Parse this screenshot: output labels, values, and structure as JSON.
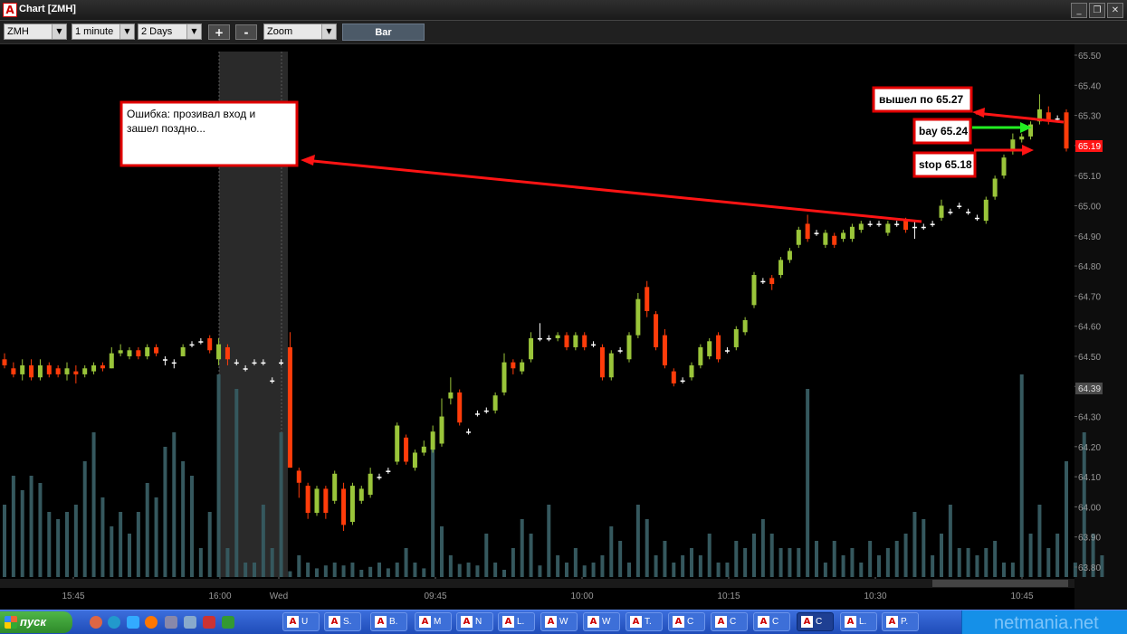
{
  "window": {
    "title": "Chart [ZMH]",
    "app_icon": "A"
  },
  "window_controls": {
    "minimize": "_",
    "restore": "❐",
    "close": "✕"
  },
  "toolbar": {
    "symbol": "ZMH",
    "interval": "1 minute",
    "period": "2 Days",
    "zoom_in": "+",
    "zoom_out": "-",
    "zoom_mode": "Zoom",
    "chart_type": "Bar"
  },
  "chart_data": {
    "type": "candlestick",
    "title": "",
    "ylim": [
      63.75,
      65.55
    ],
    "y_ticks": [
      "65.50",
      "65.40",
      "65.30",
      "65.20",
      "65.10",
      "65.00",
      "64.90",
      "64.80",
      "64.70",
      "64.60",
      "64.50",
      "64.40",
      "64.30",
      "64.20",
      "64.10",
      "64.00",
      "63.90",
      "63.80"
    ],
    "x_ticks": [
      "15:45",
      "16:00",
      "Wed",
      "09:45",
      "10:00",
      "10:15",
      "10:30",
      "10:45"
    ],
    "price_labels": {
      "last": "65.19",
      "marker": "64.39"
    },
    "colors": {
      "up": "#9ac53a",
      "down": "#ff3c0a",
      "flat": "#ffffff",
      "volume": "#35585e",
      "annotation": "#ff1414",
      "arrow_green": "#22ee22"
    },
    "annotations": {
      "error_note": "Ошибка: прозивал вход и зашел поздно...",
      "exit_note": "вышел по 65.27",
      "buy_note": "bay 65.24",
      "stop_note": "stop 65.18"
    },
    "candles": [
      [
        64.49,
        64.47,
        64.51,
        64.46
      ],
      [
        64.46,
        64.44,
        64.48,
        64.43
      ],
      [
        64.44,
        64.47,
        64.49,
        64.42
      ],
      [
        64.47,
        64.43,
        64.49,
        64.42
      ],
      [
        64.43,
        64.47,
        64.49,
        64.42
      ],
      [
        64.47,
        64.44,
        64.48,
        64.43
      ],
      [
        64.46,
        64.44,
        64.47,
        64.43
      ],
      [
        64.44,
        64.46,
        64.48,
        64.42
      ],
      [
        64.45,
        64.44,
        64.47,
        64.41
      ],
      [
        64.44,
        64.46,
        64.47,
        64.43
      ],
      [
        64.45,
        64.47,
        64.48,
        64.44
      ],
      [
        64.47,
        64.46,
        64.48,
        64.45
      ],
      [
        64.46,
        64.51,
        64.53,
        64.46
      ],
      [
        64.51,
        64.52,
        64.54,
        64.5
      ],
      [
        64.5,
        64.52,
        64.53,
        64.49
      ],
      [
        64.52,
        64.5,
        64.53,
        64.49
      ],
      [
        64.5,
        64.53,
        64.54,
        64.49
      ],
      [
        64.53,
        64.51,
        64.54,
        64.5
      ],
      [
        64.49,
        64.49,
        64.5,
        64.47
      ],
      [
        64.48,
        64.48,
        64.49,
        64.46
      ],
      [
        64.5,
        64.53,
        64.54,
        64.5
      ],
      [
        64.54,
        64.54,
        64.55,
        64.53
      ],
      [
        64.55,
        64.55,
        64.56,
        64.54
      ],
      [
        64.56,
        64.52,
        64.57,
        64.51
      ],
      [
        64.49,
        64.54,
        64.56,
        64.47
      ],
      [
        64.53,
        64.49,
        64.54,
        64.47
      ],
      [
        64.48,
        64.48,
        64.49,
        64.47
      ],
      [
        64.46,
        64.46,
        64.47,
        64.45
      ],
      [
        64.48,
        64.48,
        64.49,
        64.47
      ],
      [
        64.48,
        64.48,
        64.49,
        64.47
      ],
      [
        64.42,
        64.42,
        64.43,
        64.41
      ],
      [
        64.48,
        64.48,
        64.49,
        64.47
      ],
      [
        64.53,
        64.13,
        64.58,
        64.13
      ],
      [
        64.12,
        64.08,
        64.13,
        64.03
      ],
      [
        64.07,
        63.98,
        64.08,
        63.96
      ],
      [
        63.98,
        64.06,
        64.07,
        63.97
      ],
      [
        64.06,
        63.98,
        64.07,
        63.96
      ],
      [
        64.02,
        64.11,
        64.12,
        64.01
      ],
      [
        64.06,
        63.94,
        64.08,
        63.92
      ],
      [
        63.95,
        64.07,
        64.08,
        63.94
      ],
      [
        64.02,
        64.06,
        64.07,
        64.01
      ],
      [
        64.04,
        64.11,
        64.13,
        64.03
      ],
      [
        64.1,
        64.1,
        64.11,
        64.09
      ],
      [
        64.12,
        64.12,
        64.13,
        64.11
      ],
      [
        64.15,
        64.27,
        64.28,
        64.14
      ],
      [
        64.23,
        64.15,
        64.24,
        64.14
      ],
      [
        64.13,
        64.18,
        64.19,
        64.12
      ],
      [
        64.18,
        64.2,
        64.22,
        64.17
      ],
      [
        64.19,
        64.25,
        64.27,
        64.18
      ],
      [
        64.21,
        64.3,
        64.36,
        64.2
      ],
      [
        64.36,
        64.38,
        64.43,
        64.34
      ],
      [
        64.38,
        64.28,
        64.39,
        64.27
      ],
      [
        64.25,
        64.25,
        64.26,
        64.24
      ],
      [
        64.31,
        64.31,
        64.32,
        64.3
      ],
      [
        64.32,
        64.32,
        64.33,
        64.31
      ],
      [
        64.32,
        64.37,
        64.38,
        64.31
      ],
      [
        64.38,
        64.48,
        64.51,
        64.37
      ],
      [
        64.48,
        64.46,
        64.49,
        64.44
      ],
      [
        64.45,
        64.48,
        64.49,
        64.44
      ],
      [
        64.49,
        64.56,
        64.58,
        64.48
      ],
      [
        64.56,
        64.56,
        64.61,
        64.55
      ],
      [
        64.56,
        64.56,
        64.57,
        64.55
      ],
      [
        64.56,
        64.57,
        64.58,
        64.55
      ],
      [
        64.57,
        64.53,
        64.58,
        64.52
      ],
      [
        64.53,
        64.57,
        64.58,
        64.52
      ],
      [
        64.57,
        64.53,
        64.58,
        64.52
      ],
      [
        64.54,
        64.54,
        64.55,
        64.53
      ],
      [
        64.53,
        64.43,
        64.54,
        64.42
      ],
      [
        64.43,
        64.51,
        64.52,
        64.42
      ],
      [
        64.52,
        64.52,
        64.53,
        64.51
      ],
      [
        64.49,
        64.57,
        64.58,
        64.48
      ],
      [
        64.57,
        64.69,
        64.71,
        64.56
      ],
      [
        64.73,
        64.65,
        64.75,
        64.63
      ],
      [
        64.64,
        64.53,
        64.65,
        64.52
      ],
      [
        64.57,
        64.47,
        64.59,
        64.46
      ],
      [
        64.45,
        64.41,
        64.46,
        64.4
      ],
      [
        64.42,
        64.42,
        64.43,
        64.41
      ],
      [
        64.43,
        64.47,
        64.48,
        64.42
      ],
      [
        64.47,
        64.53,
        64.54,
        64.46
      ],
      [
        64.5,
        64.55,
        64.56,
        64.49
      ],
      [
        64.57,
        64.49,
        64.58,
        64.48
      ],
      [
        64.52,
        64.52,
        64.53,
        64.51
      ],
      [
        64.53,
        64.59,
        64.6,
        64.52
      ],
      [
        64.58,
        64.62,
        64.63,
        64.57
      ],
      [
        64.67,
        64.77,
        64.78,
        64.66
      ],
      [
        64.75,
        64.75,
        64.76,
        64.74
      ],
      [
        64.76,
        64.74,
        64.77,
        64.72
      ],
      [
        64.77,
        64.82,
        64.83,
        64.76
      ],
      [
        64.82,
        64.85,
        64.86,
        64.81
      ],
      [
        64.87,
        64.92,
        64.93,
        64.86
      ],
      [
        64.94,
        64.89,
        64.97,
        64.88
      ],
      [
        64.91,
        64.91,
        64.92,
        64.9
      ],
      [
        64.87,
        64.91,
        64.92,
        64.86
      ],
      [
        64.9,
        64.87,
        64.91,
        64.86
      ],
      [
        64.89,
        64.91,
        64.92,
        64.88
      ],
      [
        64.89,
        64.93,
        64.94,
        64.88
      ],
      [
        64.92,
        64.94,
        64.95,
        64.91
      ],
      [
        64.94,
        64.94,
        64.95,
        64.93
      ],
      [
        64.94,
        64.94,
        64.95,
        64.93
      ],
      [
        64.91,
        64.94,
        64.95,
        64.9
      ],
      [
        64.94,
        64.94,
        64.95,
        64.93
      ],
      [
        64.95,
        64.92,
        64.96,
        64.91
      ],
      [
        64.93,
        64.93,
        64.95,
        64.89
      ],
      [
        64.93,
        64.93,
        64.94,
        64.92
      ],
      [
        64.94,
        64.94,
        64.95,
        64.93
      ],
      [
        64.96,
        65.0,
        65.02,
        64.95
      ],
      [
        64.98,
        64.98,
        64.99,
        64.97
      ],
      [
        65.0,
        65.0,
        65.01,
        64.99
      ],
      [
        64.98,
        64.98,
        64.99,
        64.97
      ],
      [
        64.96,
        64.96,
        64.97,
        64.95
      ],
      [
        64.95,
        65.02,
        65.03,
        64.94
      ],
      [
        65.03,
        65.09,
        65.1,
        65.02
      ],
      [
        65.1,
        65.16,
        65.17,
        65.09
      ],
      [
        65.18,
        65.22,
        65.24,
        65.17
      ],
      [
        65.22,
        65.23,
        65.24,
        65.21
      ],
      [
        65.23,
        65.27,
        65.28,
        65.22
      ],
      [
        65.28,
        65.32,
        65.37,
        65.27
      ],
      [
        65.31,
        65.28,
        65.33,
        65.27
      ],
      [
        65.29,
        65.29,
        65.3,
        65.28
      ],
      [
        65.31,
        65.19,
        65.32,
        65.18
      ]
    ],
    "volume": [
      500,
      700,
      600,
      700,
      650,
      450,
      400,
      450,
      500,
      800,
      1000,
      550,
      350,
      450,
      300,
      450,
      650,
      550,
      900,
      1000,
      800,
      700,
      200,
      450,
      1400,
      200,
      1300,
      100,
      100,
      500,
      200,
      1000,
      40,
      150,
      100,
      60,
      80,
      100,
      80,
      100,
      50,
      70,
      100,
      60,
      100,
      200,
      100,
      60,
      1000,
      350,
      150,
      90,
      100,
      80,
      300,
      100,
      50,
      200,
      400,
      300,
      80,
      500,
      150,
      100,
      200,
      80,
      100,
      150,
      350,
      250,
      100,
      500,
      400,
      150,
      250,
      100,
      150,
      200,
      150,
      300,
      100,
      100,
      250,
      200,
      300,
      400,
      300,
      200,
      200,
      200,
      1300,
      250,
      100,
      250,
      150,
      200,
      100,
      250,
      150,
      200,
      250,
      300,
      450,
      400,
      150,
      300,
      500,
      200,
      200,
      150,
      200,
      250,
      100,
      100,
      1400,
      300,
      500,
      200,
      300,
      800,
      100,
      1000,
      300,
      150
    ]
  }
}
